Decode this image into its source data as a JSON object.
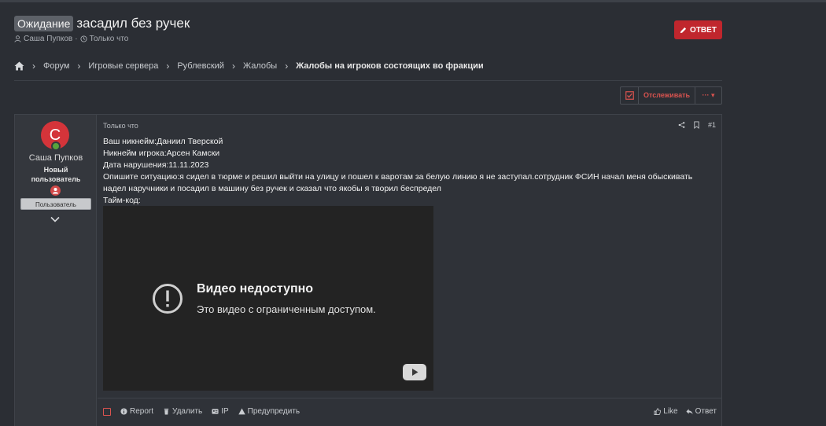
{
  "header": {
    "prefix": "Ожидание",
    "title": "засадил без ручек",
    "author": "Саша Пупков",
    "separator": "·",
    "time": "Только что",
    "reply_label": "ОТВЕТ"
  },
  "breadcrumb": {
    "items": [
      "Форум",
      "Игровые сервера",
      "Рублевский",
      "Жалобы"
    ],
    "current": "Жалобы на игроков состоящих во фракции"
  },
  "watch": {
    "label": "Отслеживать",
    "more": "···"
  },
  "post": {
    "user": {
      "avatar_letter": "С",
      "name": "Саша Пупков",
      "title_line1": "Новый",
      "title_line2": "пользователь",
      "group": "Пользователь"
    },
    "date": "Только что",
    "number": "#1",
    "lines": [
      "Ваш никнейм:Даниил Тверской",
      "Никнейм игрока:Арсен Камски",
      "Дата нарушения:11.11.2023",
      "Опишите ситуацию:я сидел в тюрме и решил выйти на улицу и пошел к варотам за белую линию я не заступал.сотрудник ФСИН начал меня обыскивать",
      "надел наручники и посадил в машину без ручек и сказал что якобы я творил беспредел",
      "Тайм-код:"
    ],
    "video": {
      "title": "Видео недоступно",
      "subtitle": "Это видео с ограниченным доступом."
    },
    "footer": {
      "report": "Report",
      "delete": "Удалить",
      "ip": "IP",
      "warn": "Предупредить",
      "like": "Like",
      "reply": "Ответ"
    }
  },
  "colors": {
    "accent": "#c0262d",
    "background": "#2b2e34",
    "online": "#5aa23c"
  }
}
